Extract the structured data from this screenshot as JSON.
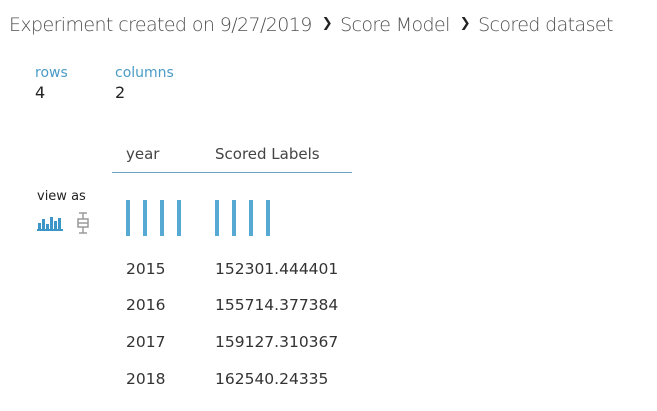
{
  "breadcrumb": {
    "items": [
      "Experiment created on 9/27/2019",
      "Score Model",
      "Scored dataset"
    ],
    "separator_icon": "chevron-right-icon"
  },
  "stats": {
    "rows_label": "rows",
    "rows_value": "4",
    "columns_label": "columns",
    "columns_value": "2"
  },
  "view_as": {
    "label": "view as",
    "options": [
      {
        "icon": "histogram-icon",
        "selected": true
      },
      {
        "icon": "boxplot-icon",
        "selected": false
      }
    ]
  },
  "table": {
    "columns": [
      "year",
      "Scored Labels"
    ],
    "rows": [
      [
        "2015",
        "152301.444401"
      ],
      [
        "2016",
        "155714.377384"
      ],
      [
        "2017",
        "159127.310367"
      ],
      [
        "2018",
        "162540.24335"
      ]
    ]
  },
  "colors": {
    "accent": "#4a9bc6",
    "histogram_bar": "#56a9d2",
    "header_rule": "#6aa5c8"
  }
}
